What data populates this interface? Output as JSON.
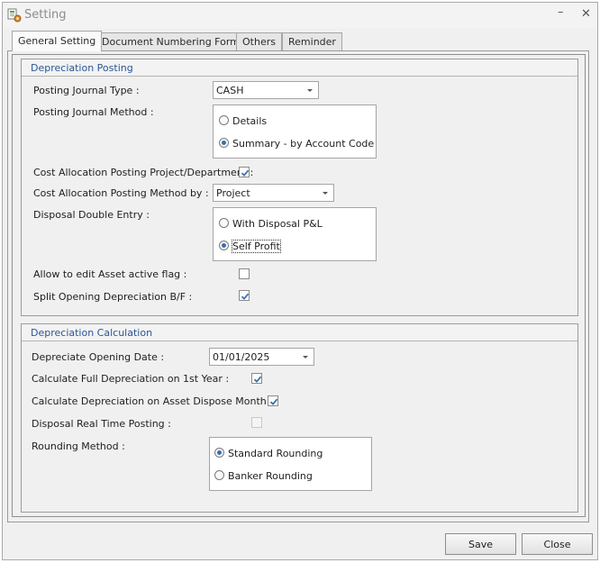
{
  "window": {
    "title": "Setting",
    "minimize": "–",
    "close": "✕"
  },
  "tabs": [
    {
      "label": "General Setting",
      "active": true
    },
    {
      "label": "Document Numbering Format",
      "active": false
    },
    {
      "label": "Others",
      "active": false
    },
    {
      "label": "Reminder",
      "active": false
    }
  ],
  "depreciation_posting": {
    "title": "Depreciation Posting",
    "posting_journal_type": {
      "label": "Posting Journal Type :",
      "value": "CASH"
    },
    "posting_journal_method": {
      "label": "Posting Journal Method :",
      "options": [
        "Details",
        "Summary - by Account Code"
      ],
      "selected": "Summary - by Account Code"
    },
    "cost_allocation_posting": {
      "label": "Cost Allocation Posting Project/Department :",
      "checked": true
    },
    "cost_allocation_method": {
      "label": "Cost Allocation Posting Method by :",
      "value": "Project"
    },
    "disposal_double_entry": {
      "label": "Disposal Double Entry :",
      "options": [
        "With Disposal P&L",
        "Self Profit"
      ],
      "selected": "Self Profit"
    },
    "allow_edit_active_flag": {
      "label": "Allow to edit Asset active flag :",
      "checked": false
    },
    "split_opening_depreciation": {
      "label": "Split Opening Depreciation B/F :",
      "checked": true
    }
  },
  "depreciation_calculation": {
    "title": "Depreciation Calculation",
    "depreciate_opening_date": {
      "label": "Depreciate Opening Date :",
      "value": "01/01/2025"
    },
    "full_depreciation_first_year": {
      "label": "Calculate Full Depreciation on 1st Year :",
      "checked": true
    },
    "depreciation_dispose_month": {
      "label": "Calculate Depreciation on Asset Dispose Month :",
      "checked": true
    },
    "disposal_real_time_posting": {
      "label": "Disposal Real Time Posting :",
      "checked": false,
      "disabled": true
    },
    "rounding_method": {
      "label": "Rounding Method :",
      "options": [
        "Standard Rounding",
        "Banker Rounding"
      ],
      "selected": "Standard Rounding"
    }
  },
  "buttons": {
    "save": "Save",
    "close": "Close"
  },
  "colors": {
    "group_title": "#2a5594",
    "radio_dot": "#3a6fb0"
  }
}
